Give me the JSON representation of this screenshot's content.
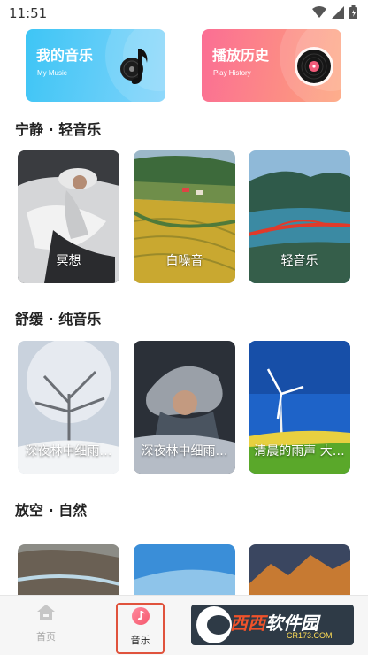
{
  "status_bar": {
    "time": "11:51",
    "icons": [
      "wifi-icon",
      "signal-icon",
      "battery-icon"
    ]
  },
  "hero": {
    "my_music": {
      "title": "我的音乐",
      "subtitle": "My Music",
      "icon": "music-note-disc-icon"
    },
    "history": {
      "title": "播放历史",
      "subtitle": "Play History",
      "icon": "vinyl-record-icon"
    }
  },
  "sections": [
    {
      "title": "宁静 · 轻音乐",
      "tiles": [
        {
          "label": "冥想"
        },
        {
          "label": "白噪音"
        },
        {
          "label": "轻音乐"
        }
      ]
    },
    {
      "title": "舒缓 · 纯音乐",
      "tiles": [
        {
          "label": "深夜林中细雨…"
        },
        {
          "label": "深夜林中细雨…"
        },
        {
          "label": "清晨的雨声 大…"
        }
      ]
    },
    {
      "title": "放空 · 自然",
      "tiles": [
        {
          "label": ""
        },
        {
          "label": ""
        },
        {
          "label": ""
        }
      ]
    }
  ],
  "bottom_nav": {
    "home": "首页",
    "music": "音乐"
  },
  "watermark": {
    "brand_left": "西西",
    "brand_right": "软件园",
    "domain": "CR173.COM"
  },
  "colors": {
    "blue_card": "#3ec5f5",
    "pink_card": "#fb6e94",
    "accent": "#e0533d"
  }
}
